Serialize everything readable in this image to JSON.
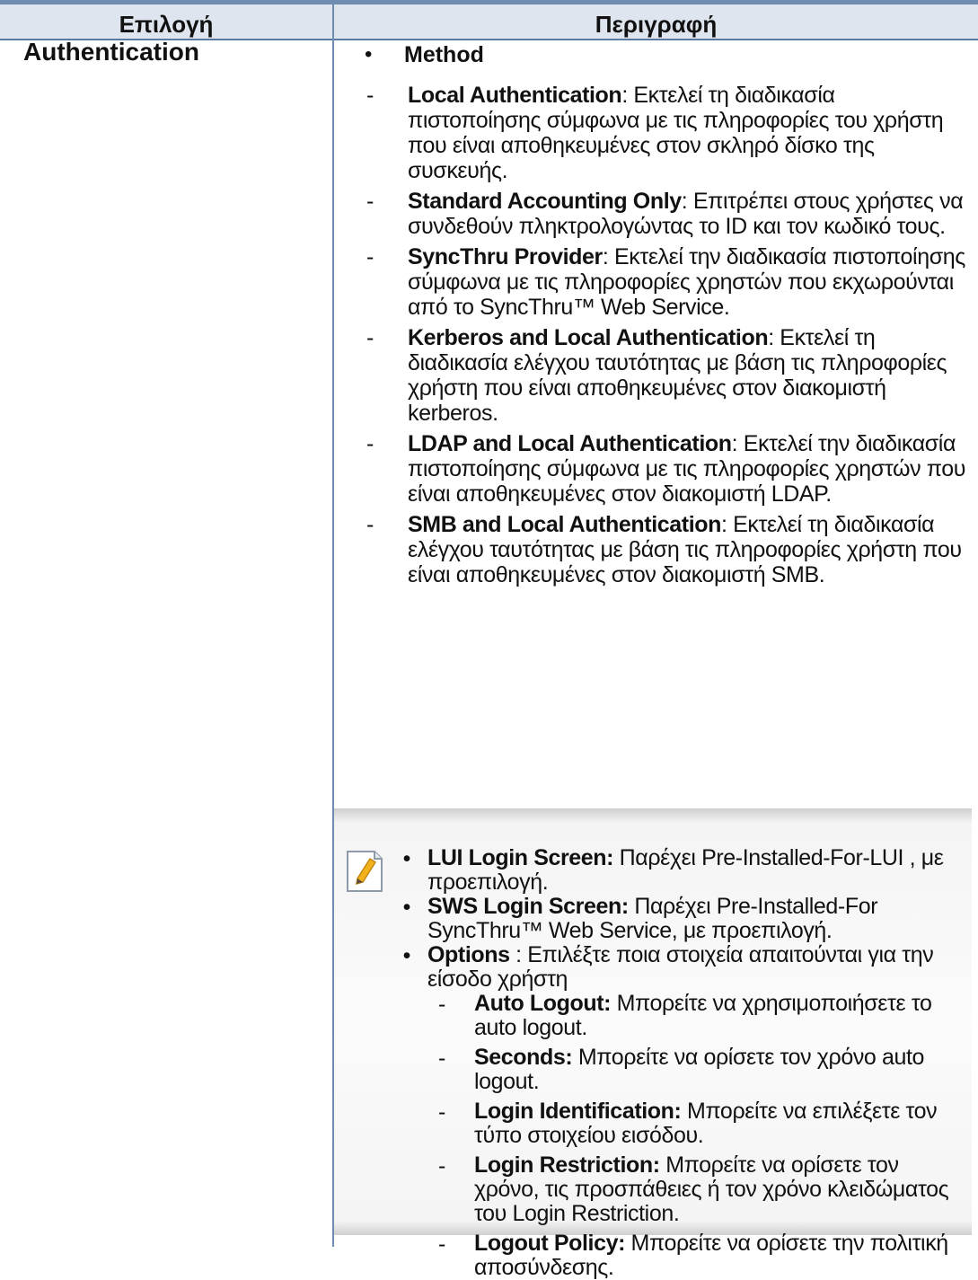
{
  "header": {
    "col_option": "Επιλογή",
    "col_description": "Περιγραφή"
  },
  "option_name": "Authentication",
  "method_label": "Method",
  "method_items": [
    {
      "term": "Local Authentication",
      "text": ": Εκτελεί τη διαδικασία πιστοποίησης σύμφωνα με τις πληροφορίες του χρήστη που είναι αποθηκευμένες στον σκληρό δίσκο της συσκευής."
    },
    {
      "term": "Standard Accounting Only",
      "text": ": Επιτρέπει στους χρήστες να συνδεθούν πληκτρολογώντας το ID και τον κωδικό τους."
    },
    {
      "term": "SyncThru Provider",
      "text": ": Εκτελεί την διαδικασία πιστοποίησης σύμφωνα με τις πληροφορίες χρηστών που εκχωρούνται από το SyncThru™ Web Service."
    },
    {
      "term": "Kerberos and Local Authentication",
      "text": ": Εκτελεί τη διαδικασία ελέγχου ταυτότητας με βάση τις πληροφορίες χρήστη που είναι αποθηκευμένες στον διακομιστή kerberos."
    },
    {
      "term": "LDAP and Local Authentication",
      "text": ": Εκτελεί την διαδικασία πιστοποίησης σύμφωνα με τις πληροφορίες χρηστών που είναι αποθηκευμένες στον διακομιστή LDAP."
    },
    {
      "term": "SMB and Local Authentication",
      "text": ": Εκτελεί τη διαδικασία ελέγχου ταυτότητας με βάση τις πληροφορίες χρήστη που είναι αποθηκευμένες στον διακομιστή SMB."
    }
  ],
  "note": {
    "icon": "note-pencil-icon",
    "bullets": [
      {
        "term": "LUI Login Screen:",
        "text": " Παρέχει Pre-Installed-For-LUI , με προεπιλογή."
      },
      {
        "term": "SWS Login Screen:",
        "text": " Παρέχει Pre-Installed-For SyncThru™ Web Service, με προεπιλογή."
      },
      {
        "term": "Options",
        "text": " : Επιλέξτε ποια στοιχεία απαιτούνται για την είσοδο χρήστη"
      }
    ],
    "options_items": [
      {
        "term": "Auto Logout:",
        "text": " Μπορείτε να χρησιμοποιήσετε το auto logout."
      },
      {
        "term": "Seconds:",
        "text": " Μπορείτε να ορίσετε τον χρόνο auto logout."
      },
      {
        "term": "Login Identification:",
        "text": " Μπορείτε να επιλέξετε τον τύπο στοιχείου εισόδου."
      },
      {
        "term": "Login Restriction:",
        "text": " Μπορείτε να ορίσετε τον χρόνο, τις προσπάθειες ή τον χρόνο κλειδώματος του Login Restriction."
      },
      {
        "term": "Logout Policy:",
        "text": " Μπορείτε να ορίσετε την πολιτική αποσύνδεσης."
      }
    ]
  }
}
